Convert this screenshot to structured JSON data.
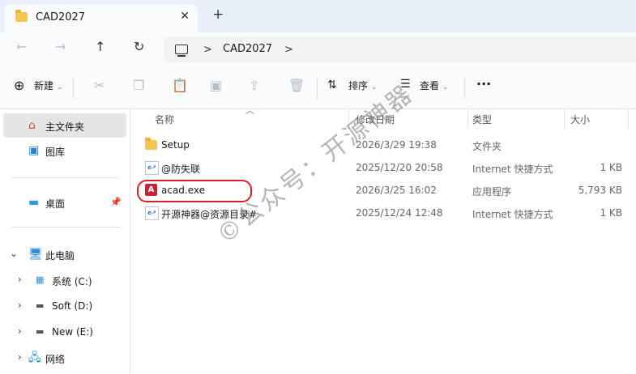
{
  "window": {
    "tab_title": "CAD2027",
    "tab_close": "✕",
    "new_tab": "+"
  },
  "nav": {
    "back": "←",
    "forward": "→",
    "up": "↑",
    "refresh": "↻",
    "crumb_sep": ">",
    "breadcrumb": "CAD2027",
    "crumb_end": ">"
  },
  "toolbar": {
    "new_label": "新建",
    "sort_label": "排序",
    "view_label": "查看",
    "more": "···"
  },
  "sidebar": {
    "items": [
      {
        "label": "主文件夹",
        "icon": "home-icon"
      },
      {
        "label": "图库",
        "icon": "gallery-icon"
      },
      {
        "label": "桌面",
        "icon": "desktop-icon"
      },
      {
        "label": "此电脑",
        "icon": "computer-icon"
      },
      {
        "label": "系统 (C:)",
        "icon": "drive-icon"
      },
      {
        "label": "Soft (D:)",
        "icon": "drive-icon"
      },
      {
        "label": "New (E:)",
        "icon": "drive-icon"
      },
      {
        "label": "网络",
        "icon": "network-icon"
      }
    ]
  },
  "columns": {
    "name": "名称",
    "modified": "修改日期",
    "type": "类型",
    "size": "大小"
  },
  "files": [
    {
      "name": "Setup",
      "modified": "2026/3/29 19:38",
      "type": "文件夹",
      "size": "",
      "icon": "folder-icon"
    },
    {
      "name": "@防失联",
      "modified": "2025/12/20 20:58",
      "type": "Internet 快捷方式",
      "size": "1 KB",
      "icon": "internet-shortcut-icon"
    },
    {
      "name": "acad.exe",
      "modified": "2026/3/25 16:02",
      "type": "应用程序",
      "size": "5,793 KB",
      "icon": "autocad-app-icon"
    },
    {
      "name": "开源神器@资源目录#",
      "modified": "2025/12/24 12:48",
      "type": "Internet 快捷方式",
      "size": "1 KB",
      "icon": "internet-shortcut-icon"
    }
  ],
  "watermark": "©公众号：开源神器",
  "colors": {
    "highlight": "#d8202a",
    "folder": "#f4c64f",
    "exe": "#c7243a"
  }
}
